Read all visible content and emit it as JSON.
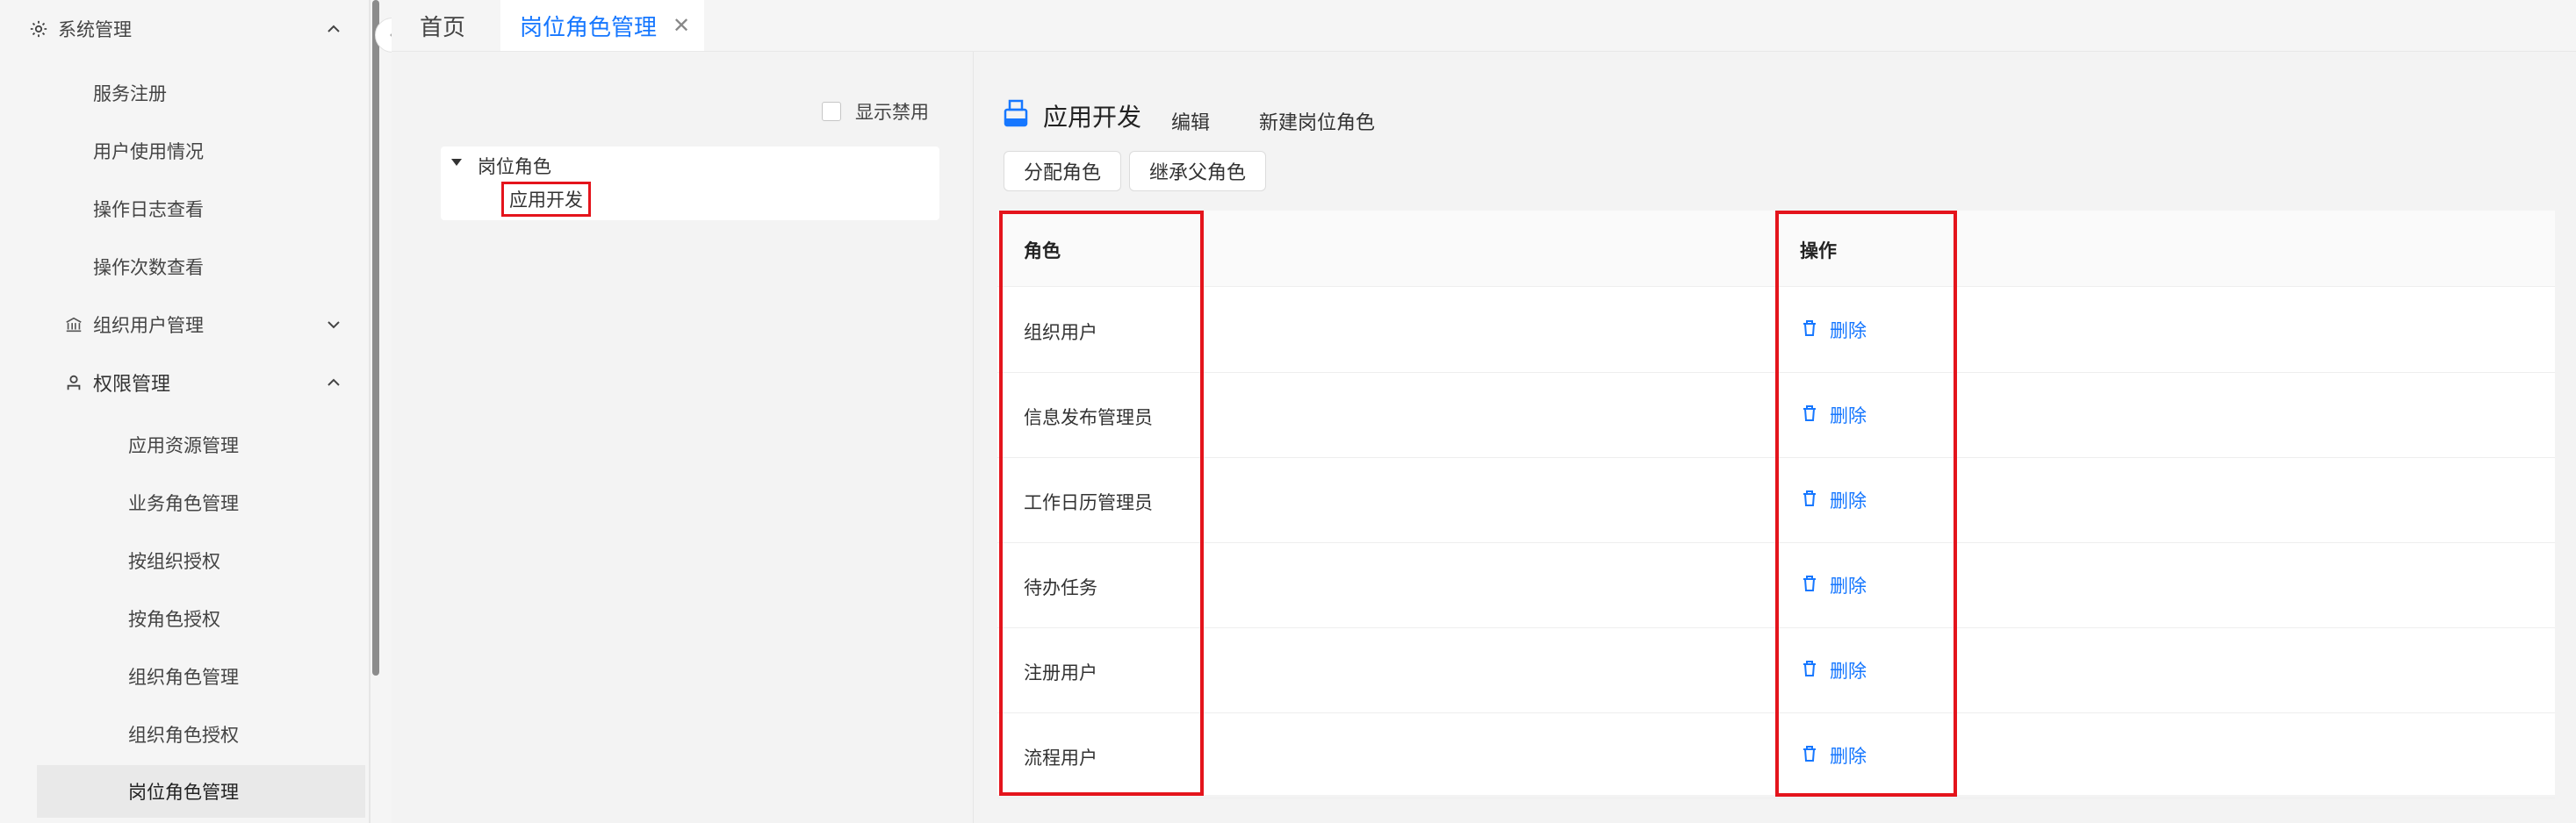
{
  "sidebar": {
    "items": [
      {
        "label": "系统管理",
        "icon": "gear-icon",
        "expanded": true
      },
      {
        "label": "服务注册"
      },
      {
        "label": "用户使用情况"
      },
      {
        "label": "操作日志查看"
      },
      {
        "label": "操作次数查看"
      },
      {
        "label": "组织用户管理",
        "icon": "bank-icon",
        "expanded": false
      },
      {
        "label": "权限管理",
        "icon": "user-icon",
        "expanded": true
      },
      {
        "label": "应用资源管理"
      },
      {
        "label": "业务角色管理"
      },
      {
        "label": "按组织授权"
      },
      {
        "label": "按角色授权"
      },
      {
        "label": "组织角色管理"
      },
      {
        "label": "组织角色授权"
      },
      {
        "label": "岗位角色管理",
        "active": true
      }
    ]
  },
  "tabs": [
    {
      "label": "首页"
    },
    {
      "label": "岗位角色管理",
      "active": true,
      "close": "✕"
    }
  ],
  "tree": {
    "show_disabled_label": "显示禁用",
    "root": "岗位角色",
    "child": "应用开发"
  },
  "detail": {
    "title": "应用开发",
    "edit_label": "编辑",
    "new_label": "新建岗位角色",
    "assign_button": "分配角色",
    "inherit_button": "继承父角色"
  },
  "table": {
    "col_role": "角色",
    "col_action": "操作",
    "delete_label": "删除",
    "rows": [
      "组织用户",
      "信息发布管理员",
      "工作日历管理员",
      "待办任务",
      "注册用户",
      "流程用户"
    ]
  },
  "colors": {
    "accent": "#1677ff",
    "highlight": "#e4141c"
  }
}
